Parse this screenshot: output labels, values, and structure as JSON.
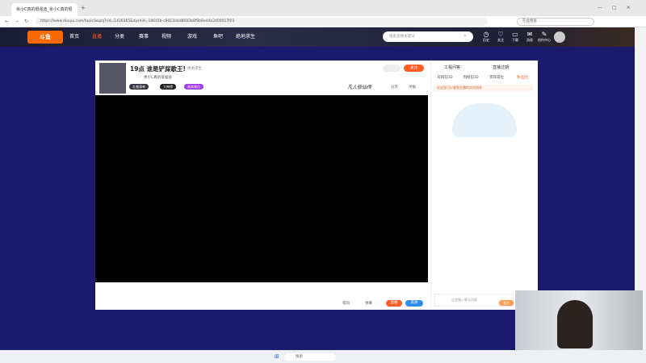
{
  "browser": {
    "tab_title": "余小C真的很强迪_余小C真的很",
    "url": "https://www.douyu.com/topic/wqzq?rid=1430365&dyshid=186d1b-c8013ebd8683b8f9b8ed4e2400017f01",
    "search_placeholder": "在此搜索"
  },
  "site": {
    "nav": [
      "首页",
      "直播",
      "分类",
      "赛事",
      "视频",
      "游戏",
      "鱼吧",
      "绝地求生"
    ],
    "search_placeholder": "搜索直播关键词",
    "header_icons": [
      "历史",
      "关注",
      "下载",
      "消息",
      "创作中心"
    ]
  },
  "room": {
    "title": "19点 谁是铲屎歌王!",
    "category": "绝地求生",
    "anchor_name": "余小C真的很强迪",
    "follow_label": "关注",
    "share_label": "分享",
    "report_label": "举报",
    "badges": [
      "礼物清单",
      "大神榜",
      "贵宾席位"
    ],
    "bottom_controls": [
      "夜间",
      "弹幕",
      "直播",
      "高清"
    ],
    "brand_watermark": "凡人修仙传"
  },
  "right_panel": {
    "top_links": [
      "工程问答",
      "直播过期"
    ],
    "tabs": [
      "日榜前30",
      "周榜前30",
      "贵宾席位",
      "粉丝团"
    ],
    "notice": "在这里可以看到主播的实时消息",
    "chat_placeholder": "这里输入聊天内容",
    "send_label": "发送"
  },
  "taskbar": {
    "search": "搜索"
  }
}
